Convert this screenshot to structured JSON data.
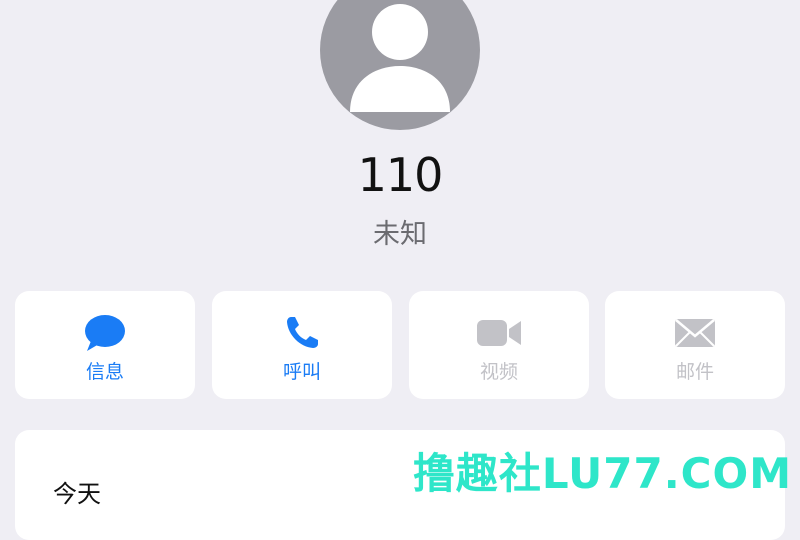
{
  "contact": {
    "name": "110",
    "subtitle": "未知"
  },
  "actions": [
    {
      "label": "信息",
      "icon": "message-bubble-icon",
      "enabled": true
    },
    {
      "label": "呼叫",
      "icon": "phone-icon",
      "enabled": true
    },
    {
      "label": "视频",
      "icon": "video-camera-icon",
      "enabled": false
    },
    {
      "label": "邮件",
      "icon": "mail-envelope-icon",
      "enabled": false
    }
  ],
  "history": {
    "title": "今天"
  },
  "watermark": "撸趣社LU77.COM",
  "colors": {
    "accent": "#1a7cf5",
    "disabled": "#c2c2c7",
    "background": "#efeef4",
    "avatar": "#9b9ba2",
    "watermark": "#2ee6c9"
  }
}
